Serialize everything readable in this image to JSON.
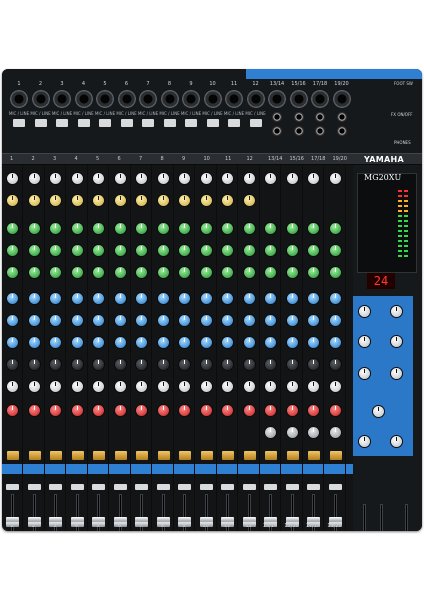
{
  "brand": "YAMAHA",
  "model": "MG20XU",
  "display_value": "24",
  "rear_labels": {
    "mic_line": "MIC / LINE",
    "phones": "PHONES",
    "foot_sw": "FOOT SW",
    "fx_on_off": "FX ON/OFF"
  },
  "channels": [
    "1",
    "2",
    "3",
    "4",
    "5",
    "6",
    "7",
    "8",
    "9",
    "10",
    "11",
    "12",
    "13/14",
    "15/16",
    "17/18",
    "19/20"
  ],
  "colors": {
    "accent_blue": "#2f7fd3",
    "panel": "#121416",
    "on_button": "#e0aa40",
    "display_red": "#ff3b2f"
  },
  "icons": [
    "xlr-jack-icon",
    "phone-jack-icon",
    "knob-icon",
    "fader-icon",
    "yamaha-logo-icon"
  ]
}
